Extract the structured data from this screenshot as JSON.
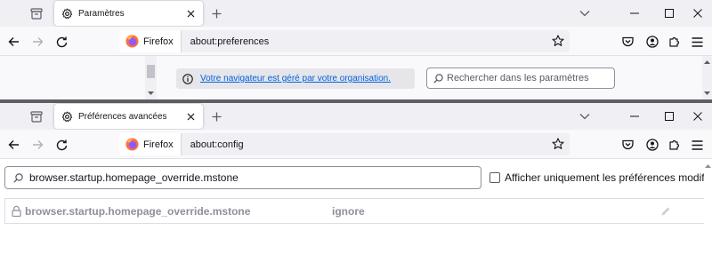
{
  "window1": {
    "tab": {
      "title": "Paramètres",
      "icon": "gear-icon"
    },
    "urlbar": {
      "identity_label": "Firefox",
      "url": "about:preferences"
    },
    "notice": {
      "link_text": "Votre navigateur est géré par votre organisation."
    },
    "search": {
      "placeholder": "Rechercher dans les paramètres"
    }
  },
  "window2": {
    "tab": {
      "title": "Préférences avancées",
      "icon": "gear-icon"
    },
    "urlbar": {
      "identity_label": "Firefox",
      "url": "about:config"
    },
    "config_search": {
      "value": "browser.startup.homepage_override.mstone"
    },
    "modified_only": {
      "label": "Afficher uniquement les préférences modifiées",
      "checked": false
    },
    "rows": [
      {
        "name": "browser.startup.homepage_override.mstone",
        "value": "ignore",
        "locked": true
      }
    ]
  },
  "colors": {
    "tabstrip": "#f0f0f4",
    "link": "#0061e0",
    "locked_text": "#8f8f9d",
    "firefox_orange": "#ff7139",
    "firefox_purple": "#9059ff"
  }
}
